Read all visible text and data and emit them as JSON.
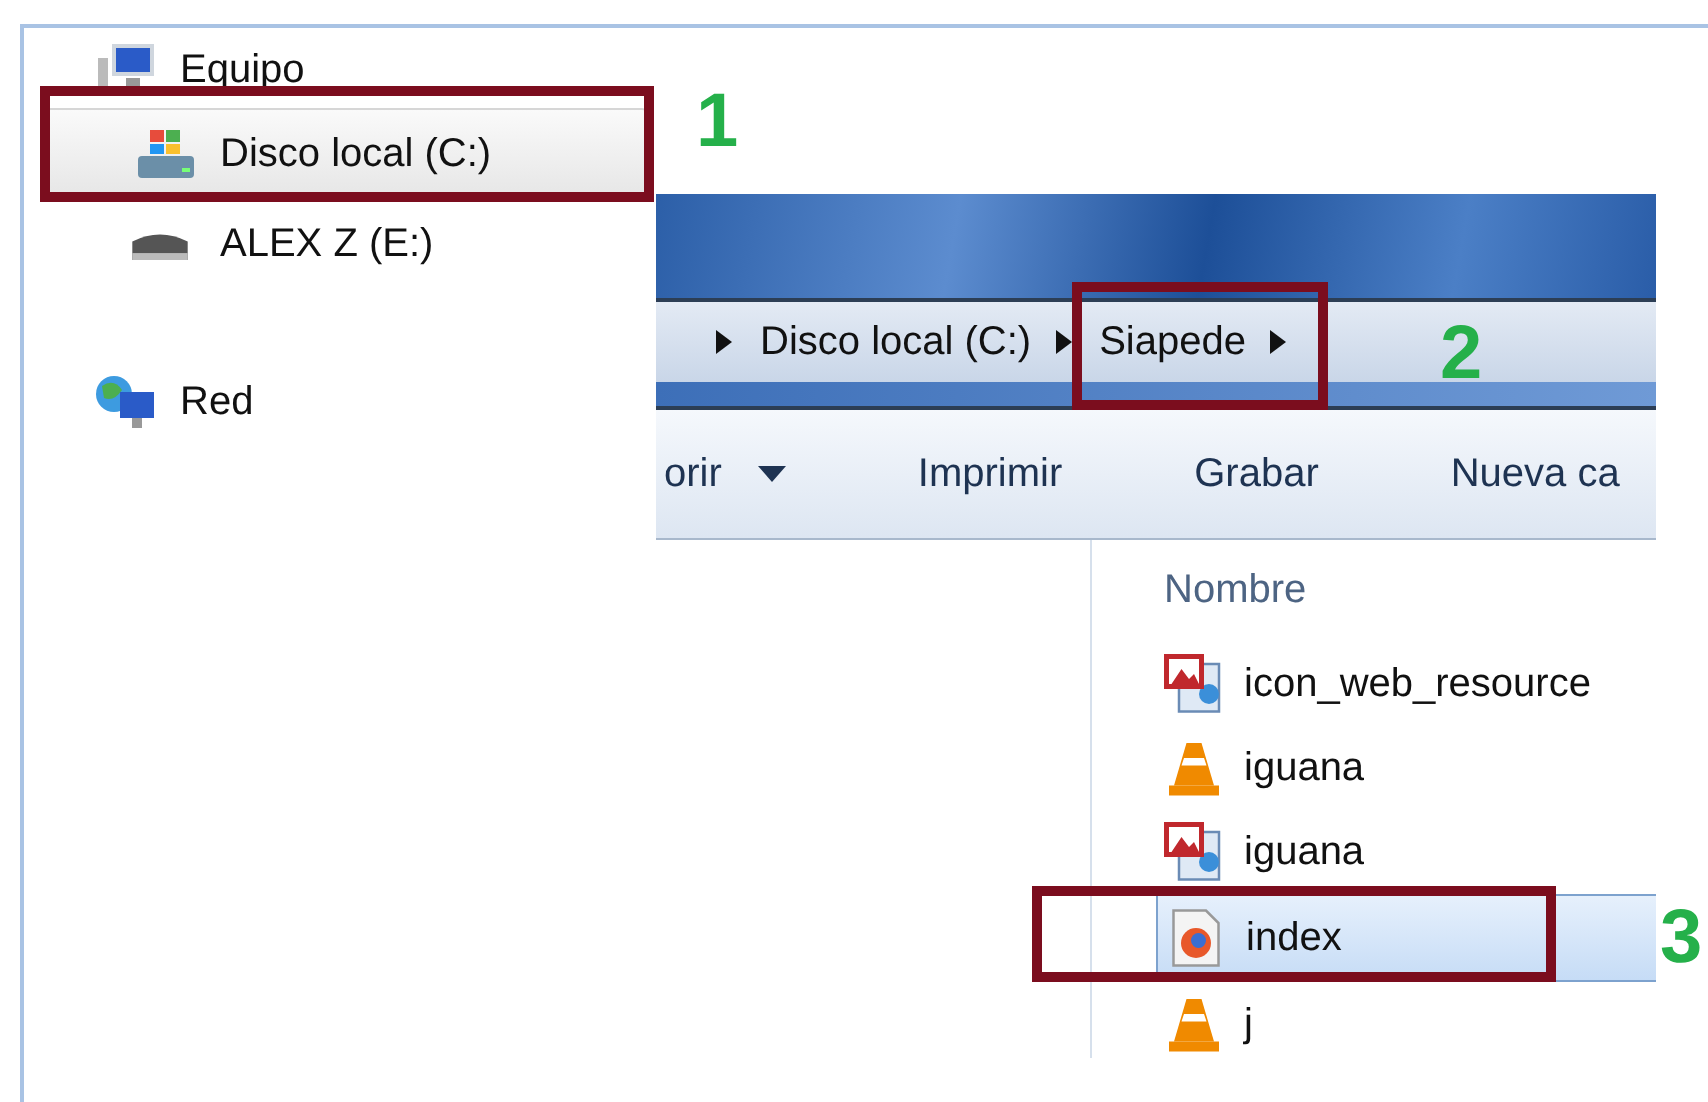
{
  "nav": [
    {
      "label": "Equipo",
      "kind": "computer",
      "selected": false,
      "children": [
        {
          "label": "Disco local (C:)",
          "kind": "system-drive",
          "selected": true
        },
        {
          "label": "ALEX Z (E:)",
          "kind": "removable-drive",
          "selected": false
        }
      ]
    },
    {
      "label": "Red",
      "kind": "network",
      "selected": false
    }
  ],
  "breadcrumb": [
    "Disco local (C:)",
    "Siapede"
  ],
  "toolbar": [
    {
      "label": "orir",
      "dropdown": true
    },
    {
      "label": "Imprimir",
      "dropdown": false
    },
    {
      "label": "Grabar",
      "dropdown": false
    },
    {
      "label": "Nueva ca",
      "dropdown": false
    }
  ],
  "column_header": "Nombre",
  "files": [
    {
      "name": "icon_web_resource",
      "kind": "image",
      "selected": false
    },
    {
      "name": "iguana",
      "kind": "video",
      "selected": false
    },
    {
      "name": "iguana",
      "kind": "image",
      "selected": false
    },
    {
      "name": "index",
      "kind": "html",
      "selected": true
    },
    {
      "name": "j",
      "kind": "video",
      "selected": false
    }
  ],
  "callouts": [
    "1",
    "2",
    "3"
  ]
}
